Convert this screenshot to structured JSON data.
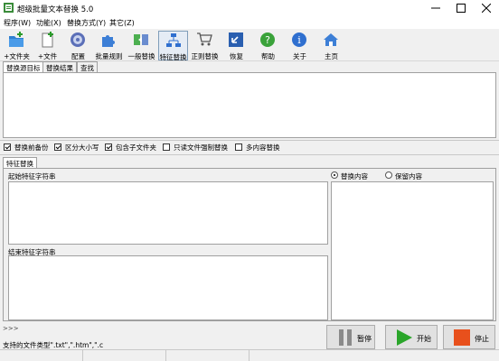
{
  "window": {
    "title": "超级批量文本替换 5.0"
  },
  "menu": {
    "items": [
      {
        "label": "程序(W)"
      },
      {
        "label": "功能(X)"
      },
      {
        "label": "替换方式(Y)"
      },
      {
        "label": "其它(Z)"
      }
    ]
  },
  "toolbar": {
    "buttons": [
      {
        "label": "+文件夹",
        "icon": "add-folder-icon"
      },
      {
        "label": "+文件",
        "icon": "add-file-icon"
      },
      {
        "label": "配置",
        "icon": "config-icon"
      },
      {
        "label": "批量规则",
        "icon": "puzzle-icon"
      },
      {
        "label": "一般替换",
        "icon": "replace-icon"
      },
      {
        "label": "特征替换",
        "icon": "feature-replace-icon"
      },
      {
        "label": "正则替换",
        "icon": "cart-icon"
      },
      {
        "label": "恢复",
        "icon": "restore-icon"
      },
      {
        "label": "帮助",
        "icon": "help-icon"
      },
      {
        "label": "关于",
        "icon": "info-icon"
      },
      {
        "label": "主页",
        "icon": "home-icon"
      }
    ]
  },
  "top_tabs": [
    {
      "label": "替换源目标"
    },
    {
      "label": "替换结果"
    },
    {
      "label": "查找"
    }
  ],
  "options": [
    {
      "label": "替换前备份",
      "checked": true
    },
    {
      "label": "区分大小写",
      "checked": true
    },
    {
      "label": "包含子文件夹",
      "checked": true
    },
    {
      "label": "只读文件强制替换",
      "checked": false
    },
    {
      "label": "多内容替换",
      "checked": false
    }
  ],
  "feature_tab": {
    "label": "特征替换"
  },
  "feature": {
    "start_label": "起始特征字符串",
    "end_label": "结束特征字符串",
    "radio_replace": "替换内容",
    "radio_keep": "保留内容"
  },
  "log_prefix": ">>>",
  "status": {
    "supported_types": "支持的文件类型\".txt\",\".htm\",\".c"
  },
  "actions": {
    "pause": "暂停",
    "start": "开始",
    "stop": "停止"
  }
}
